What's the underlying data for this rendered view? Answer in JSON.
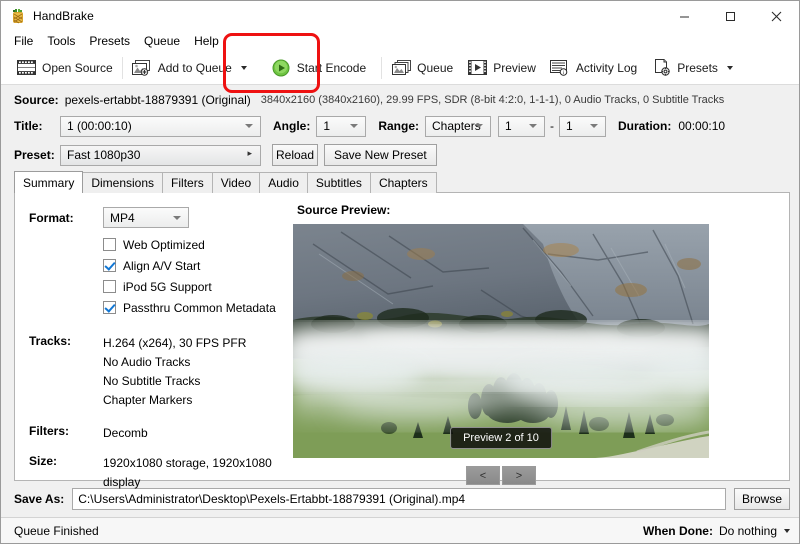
{
  "window": {
    "title": "HandBrake",
    "app_icon": "handbrake-pineapple-icon",
    "minimize": "—",
    "maximize": "□",
    "close": "✕"
  },
  "menubar": {
    "items": [
      "File",
      "Tools",
      "Presets",
      "Queue",
      "Help"
    ]
  },
  "toolbar": {
    "open_source": "Open Source",
    "add_to_queue": "Add to Queue",
    "start_encode": "Start Encode",
    "queue": "Queue",
    "preview": "Preview",
    "activity_log": "Activity Log",
    "presets": "Presets",
    "highlight_color": "#ee1111"
  },
  "source": {
    "label": "Source:",
    "name": "pexels-ertabbt-18879391 (Original)",
    "meta": "3840x2160 (3840x2160), 29.99 FPS, SDR (8-bit 4:2:0, 1-1-1), 0 Audio Tracks, 0 Subtitle Tracks"
  },
  "title_row": {
    "title_label": "Title:",
    "title_value": "1 (00:00:10)",
    "angle_label": "Angle:",
    "angle_value": "1",
    "range_label": "Range:",
    "range_value": "Chapters",
    "range_from": "1",
    "range_dash": "-",
    "range_to": "1",
    "duration_label": "Duration:",
    "duration_value": "00:00:10"
  },
  "preset_row": {
    "label": "Preset:",
    "value": "Fast 1080p30",
    "reload": "Reload",
    "save_new_preset": "Save New Preset"
  },
  "tabs": [
    {
      "label": "Summary",
      "active": true
    },
    {
      "label": "Dimensions",
      "active": false
    },
    {
      "label": "Filters",
      "active": false
    },
    {
      "label": "Video",
      "active": false
    },
    {
      "label": "Audio",
      "active": false
    },
    {
      "label": "Subtitles",
      "active": false
    },
    {
      "label": "Chapters",
      "active": false
    }
  ],
  "summary": {
    "format_label": "Format:",
    "format_value": "MP4",
    "checkboxes": [
      {
        "label": "Web Optimized",
        "checked": false
      },
      {
        "label": "Align A/V Start",
        "checked": true
      },
      {
        "label": "iPod 5G Support",
        "checked": false
      },
      {
        "label": "Passthru Common Metadata",
        "checked": true
      }
    ],
    "tracks_label": "Tracks:",
    "tracks": [
      "H.264 (x264), 30 FPS PFR",
      "No Audio Tracks",
      "No Subtitle Tracks",
      "Chapter Markers"
    ],
    "filters_label": "Filters:",
    "filters_value": "Decomb",
    "size_label": "Size:",
    "size_value": "1920x1080 storage, 1920x1080 display"
  },
  "preview": {
    "title": "Source Preview:",
    "badge": "Preview 2 of 10",
    "prev_button": "<",
    "next_button": ">",
    "scene": "mountain-cliff-with-fog-over-green-meadow"
  },
  "save_as": {
    "label": "Save As:",
    "path": "C:\\Users\\Administrator\\Desktop\\Pexels-Ertabbt-18879391 (Original).mp4",
    "browse": "Browse"
  },
  "status": {
    "queue_status": "Queue Finished",
    "when_done_label": "When Done:",
    "when_done_value": "Do nothing"
  }
}
